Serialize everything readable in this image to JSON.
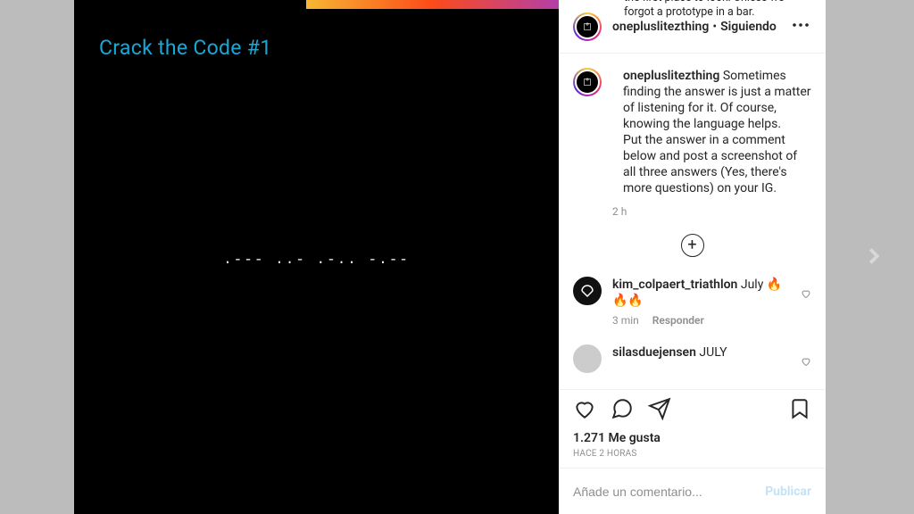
{
  "media": {
    "title": "Crack the Code #1",
    "morse": ".--- ..- .-.. -.--"
  },
  "header": {
    "username": "onepluslitezthing",
    "sep": "•",
    "follow_label": "Siguiendo"
  },
  "caption": {
    "username": "onepluslitezthing",
    "text_1": "Sometimes finding the answer is just a matter of listening for it. Of course, knowing the language helps.",
    "text_2": "Put the answer in a comment below and post a screenshot of all three answers (Yes, there's more questions) on your IG.",
    "time": "2 h"
  },
  "plus_label": "+",
  "comments": [
    {
      "username": "kim_colpaert_triathlon",
      "text": "July 🔥🔥🔥",
      "time": "3 min",
      "reply_label": "Responder"
    },
    {
      "username": "silasduejensen",
      "text": "JULY"
    }
  ],
  "likes": "1.271 Me gusta",
  "posted_time": "HACE 2 HORAS",
  "add_comment": {
    "placeholder": "Añade un comentario...",
    "publish_label": "Publicar"
  },
  "partial_caption": "the first place to look. Unless we forgot a prototype in a bar."
}
